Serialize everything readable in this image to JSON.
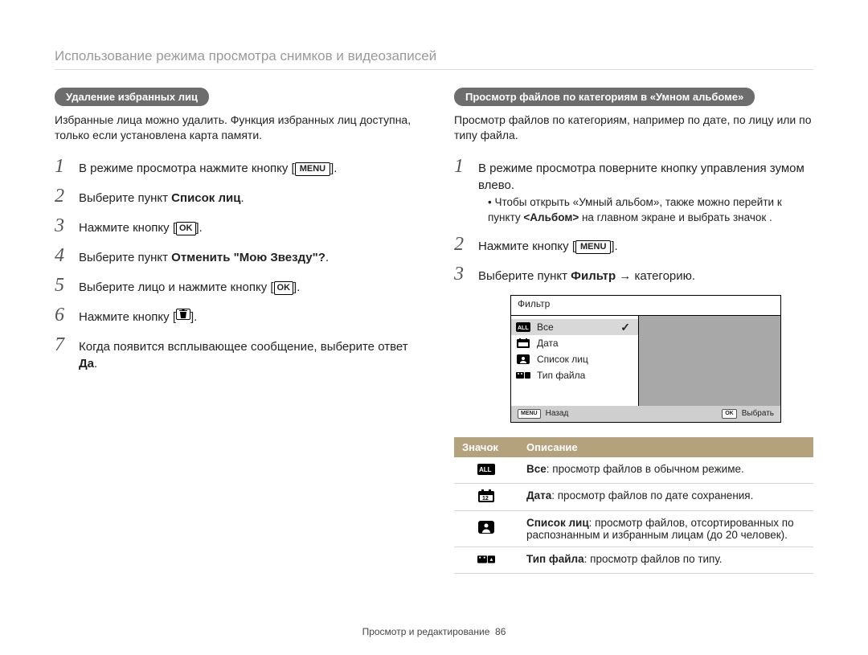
{
  "header": {
    "title": "Использование режима просмотра снимков и видеозаписей"
  },
  "left": {
    "section_pill": "Удаление избранных лиц",
    "intro": "Избранные лица можно удалить. Функция избранных лиц доступна, только если установлена карта памяти.",
    "steps": [
      {
        "num": "1",
        "pre": "В режиме просмотра нажмите кнопку [",
        "icon": "MENU",
        "post": "]."
      },
      {
        "num": "2",
        "pre": "Выберите пункт ",
        "bold": "Список лиц",
        "post": "."
      },
      {
        "num": "3",
        "pre": "Нажмите кнопку [",
        "icon": "OK",
        "post": "]."
      },
      {
        "num": "4",
        "pre": "Выберите пункт ",
        "bold": "Отменить \"Мою Звезду\"?",
        "post": "."
      },
      {
        "num": "5",
        "pre": "Выберите лицо и нажмите кнопку [",
        "icon": "OK",
        "post": "]."
      },
      {
        "num": "6",
        "pre": "Нажмите кнопку [",
        "icon": "TRASH",
        "post": "]."
      },
      {
        "num": "7",
        "pre": "Когда появится всплывающее сообщение, выберите ответ ",
        "bold": "Да",
        "post": "."
      }
    ]
  },
  "right": {
    "section_pill": "Просмотр файлов по категориям в «Умном альбоме»",
    "intro": "Просмотр файлов по категориям, например по дате, по лицу или по типу файла.",
    "steps": [
      {
        "num": "1",
        "text": "В режиме просмотра поверните кнопку управления зумом влево.",
        "sub": {
          "pre": "Чтобы открыть «Умный альбом», также можно перейти к пункту ",
          "bold": "<Альбом>",
          "post": " на главном экране и выбрать значок ."
        }
      },
      {
        "num": "2",
        "pre": "Нажмите кнопку [",
        "icon": "MENU",
        "post": "]."
      },
      {
        "num": "3",
        "pre": "Выберите пункт ",
        "bold": "Фильтр",
        "post": " → категорию."
      }
    ],
    "filter_ui": {
      "title": "Фильтр",
      "items": [
        {
          "icon": "all",
          "label": "Все",
          "selected": true
        },
        {
          "icon": "date",
          "label": "Дата",
          "selected": false
        },
        {
          "icon": "face",
          "label": "Список лиц",
          "selected": false
        },
        {
          "icon": "filetype",
          "label": "Тип файла",
          "selected": false
        }
      ],
      "back_btn": {
        "icon_label": "MENU",
        "text": "Назад"
      },
      "select_btn": {
        "icon_label": "OK",
        "text": "Выбрать"
      }
    },
    "table": {
      "head": {
        "icon": "Значок",
        "desc": "Описание"
      },
      "rows": [
        {
          "icon": "all",
          "bold": "Все",
          "rest": ": просмотр файлов в обычном режиме."
        },
        {
          "icon": "date",
          "bold": "Дата",
          "rest": ": просмотр файлов по дате сохранения."
        },
        {
          "icon": "face",
          "bold": "Список лиц",
          "rest": ": просмотр файлов, отсортированных по распознанным и избранным лицам (до 20 человек)."
        },
        {
          "icon": "filetype",
          "bold": "Тип файла",
          "rest": ": просмотр файлов по типу."
        }
      ]
    }
  },
  "footer": {
    "section": "Просмотр и редактирование",
    "page": "86"
  },
  "icons": {
    "MENU": "MENU",
    "OK": "OK"
  }
}
